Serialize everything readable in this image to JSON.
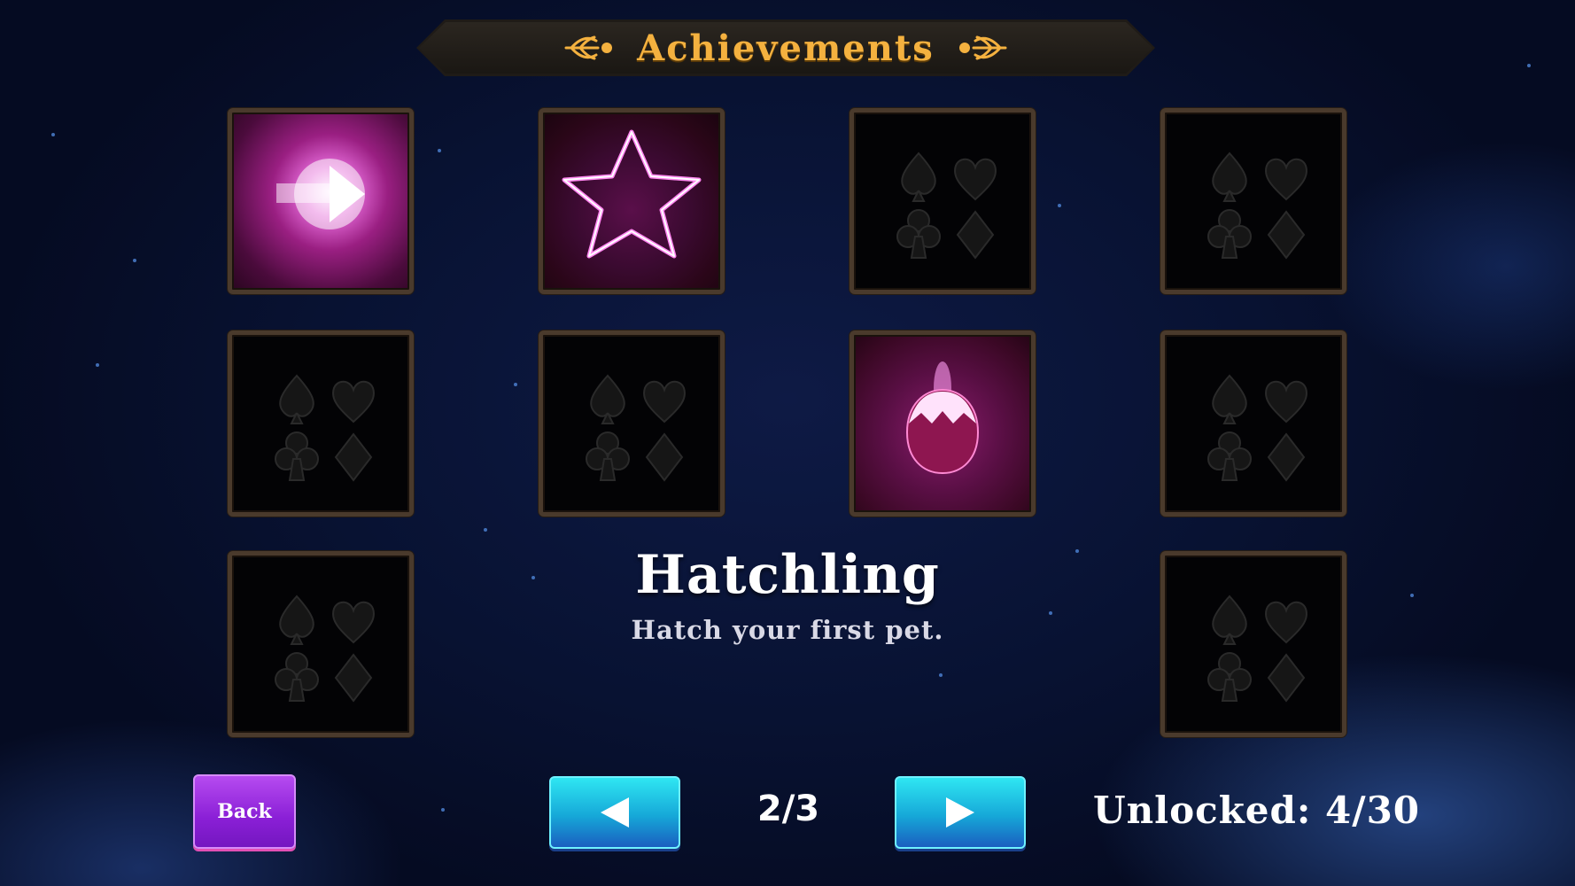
{
  "header": {
    "title": "Achievements"
  },
  "selected": {
    "name": "Hatchling",
    "description": "Hatch your first pet."
  },
  "tiles": [
    {
      "state": "unlocked",
      "art": "arrow-burst-icon"
    },
    {
      "state": "unlocked",
      "art": "star-icon"
    },
    {
      "state": "locked",
      "art": "card-suits-icon"
    },
    {
      "state": "locked",
      "art": "card-suits-icon"
    },
    {
      "state": "locked",
      "art": "card-suits-icon"
    },
    {
      "state": "locked",
      "art": "card-suits-icon"
    },
    {
      "state": "unlocked",
      "art": "egg-icon"
    },
    {
      "state": "locked",
      "art": "card-suits-icon"
    },
    {
      "state": "locked",
      "art": "card-suits-icon"
    },
    {
      "state": "locked",
      "art": "card-suits-icon"
    }
  ],
  "footer": {
    "back_label": "Back",
    "prev_icon": "triangle-left-icon",
    "next_icon": "triangle-right-icon",
    "page": "2/3",
    "unlocked": "Unlocked: 4/30"
  },
  "colors": {
    "title": "#f4b13f",
    "back_button": "#8a1fd6",
    "nav_button": "#16a8d8"
  }
}
